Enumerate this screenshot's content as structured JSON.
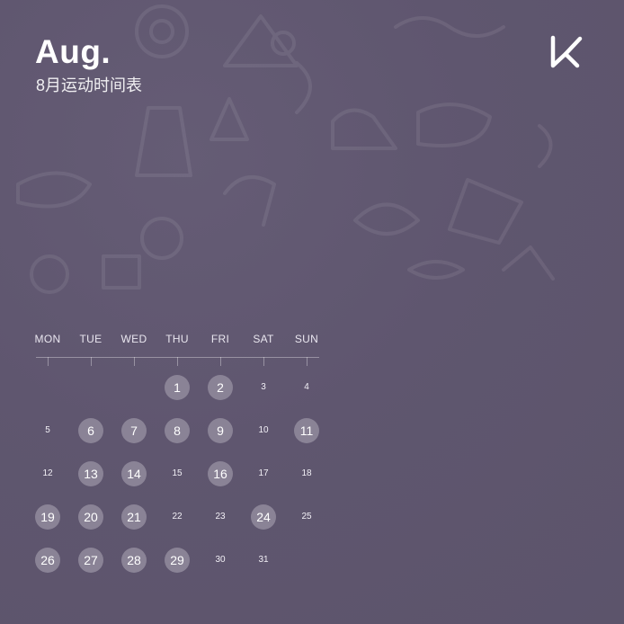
{
  "header": {
    "title": "Aug.",
    "subtitle": "8月运动时间表"
  },
  "logo": {
    "icon": "keep-logo-icon"
  },
  "calendar": {
    "weekdays": [
      "MON",
      "TUE",
      "WED",
      "THU",
      "FRI",
      "SAT",
      "SUN"
    ],
    "start_weekday_index": 3,
    "days": [
      {
        "label": "1",
        "active": true
      },
      {
        "label": "2",
        "active": true
      },
      {
        "label": "3",
        "active": false
      },
      {
        "label": "4",
        "active": false
      },
      {
        "label": "5",
        "active": false
      },
      {
        "label": "6",
        "active": true
      },
      {
        "label": "7",
        "active": true
      },
      {
        "label": "8",
        "active": true
      },
      {
        "label": "9",
        "active": true
      },
      {
        "label": "10",
        "active": false
      },
      {
        "label": "11",
        "active": true
      },
      {
        "label": "12",
        "active": false
      },
      {
        "label": "13",
        "active": true
      },
      {
        "label": "14",
        "active": true
      },
      {
        "label": "15",
        "active": false
      },
      {
        "label": "16",
        "active": true
      },
      {
        "label": "17",
        "active": false
      },
      {
        "label": "18",
        "active": false
      },
      {
        "label": "19",
        "active": true
      },
      {
        "label": "20",
        "active": true
      },
      {
        "label": "21",
        "active": true
      },
      {
        "label": "22",
        "active": false
      },
      {
        "label": "23",
        "active": false
      },
      {
        "label": "24",
        "active": true
      },
      {
        "label": "25",
        "active": false
      },
      {
        "label": "26",
        "active": true
      },
      {
        "label": "27",
        "active": true
      },
      {
        "label": "28",
        "active": true
      },
      {
        "label": "29",
        "active": true
      },
      {
        "label": "30",
        "active": false
      },
      {
        "label": "31",
        "active": false
      }
    ]
  },
  "colors": {
    "background": "#5f566f",
    "active_day": "#8a8396",
    "text": "#ffffff"
  }
}
